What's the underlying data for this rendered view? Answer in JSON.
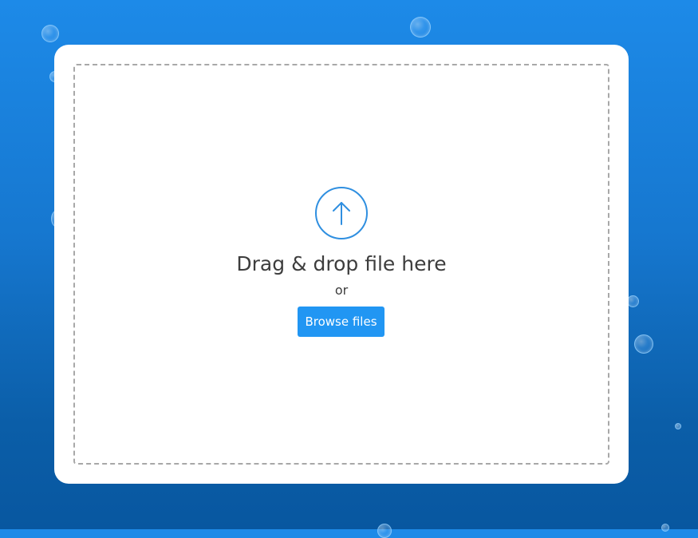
{
  "dropzone": {
    "title": "Drag & drop file here",
    "or_text": "or",
    "browse_label": "Browse files",
    "icon": "upload-arrow-icon"
  },
  "colors": {
    "accent": "#2196f3",
    "icon_stroke": "#2f8fe0",
    "text": "#3d3d3d",
    "card": "#ffffff"
  }
}
